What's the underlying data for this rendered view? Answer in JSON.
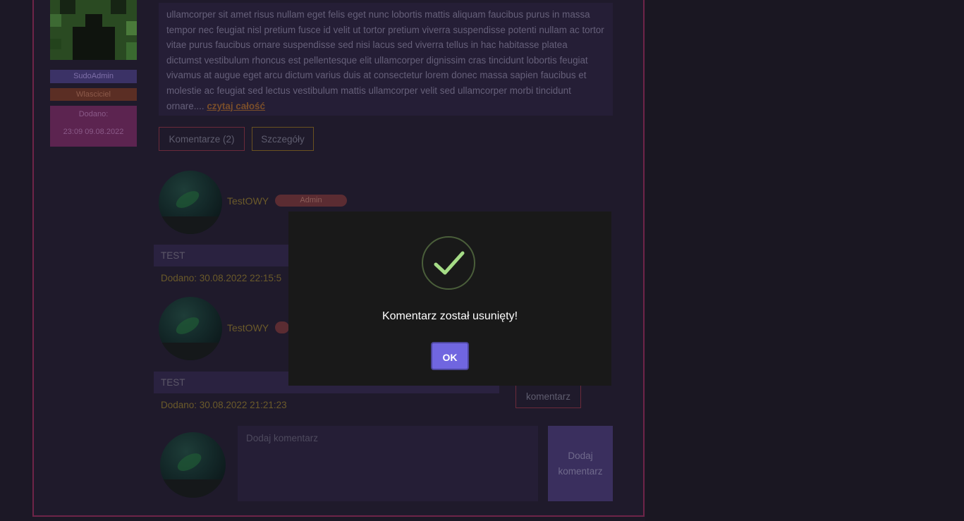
{
  "post": {
    "text": "ullamcorper sit amet risus nullam eget felis eget nunc lobortis mattis aliquam faucibus purus in massa tempor nec feugiat nisl pretium fusce id velit ut tortor pretium viverra suspendisse potenti nullam ac tortor vitae purus faucibus ornare suspendisse sed nisi lacus sed viverra tellus in hac habitasse platea dictumst vestibulum rhoncus est pellentesque elit ullamcorper dignissim cras tincidunt lobortis feugiat vivamus at augue eget arcu dictum varius duis at consectetur lorem donec massa sapien faucibus et molestie ac feugiat sed lectus vestibulum mattis ullamcorper velit sed ullamcorper morbi tincidunt ornare....",
    "read_more": "czytaj całość",
    "comments_button": "Komentarze (2)",
    "details_button": "Szczegóły"
  },
  "author": {
    "username": "SudoAdmin",
    "role": "Wlasciciel",
    "added_label": "Dodano:",
    "added_date": "23:09 09.08.2022"
  },
  "comments": [
    {
      "author": "TestOWY",
      "badge": "Admin",
      "text": "TEST",
      "date": "Dodano: 30.08.2022 22:15:5"
    },
    {
      "author": "TestOWY",
      "badge": "",
      "text": "TEST",
      "date": "Dodano: 30.08.2022 21:21:23"
    }
  ],
  "comment_action": "komentarz",
  "add_comment": {
    "placeholder": "Dodaj komentarz",
    "button_line1": "Dodaj",
    "button_line2": "komentarz"
  },
  "modal": {
    "message": "Komentarz został usunięty!",
    "ok": "OK"
  },
  "colors": {
    "ok_button": "#7066e0",
    "success_check": "#a5dc86"
  }
}
